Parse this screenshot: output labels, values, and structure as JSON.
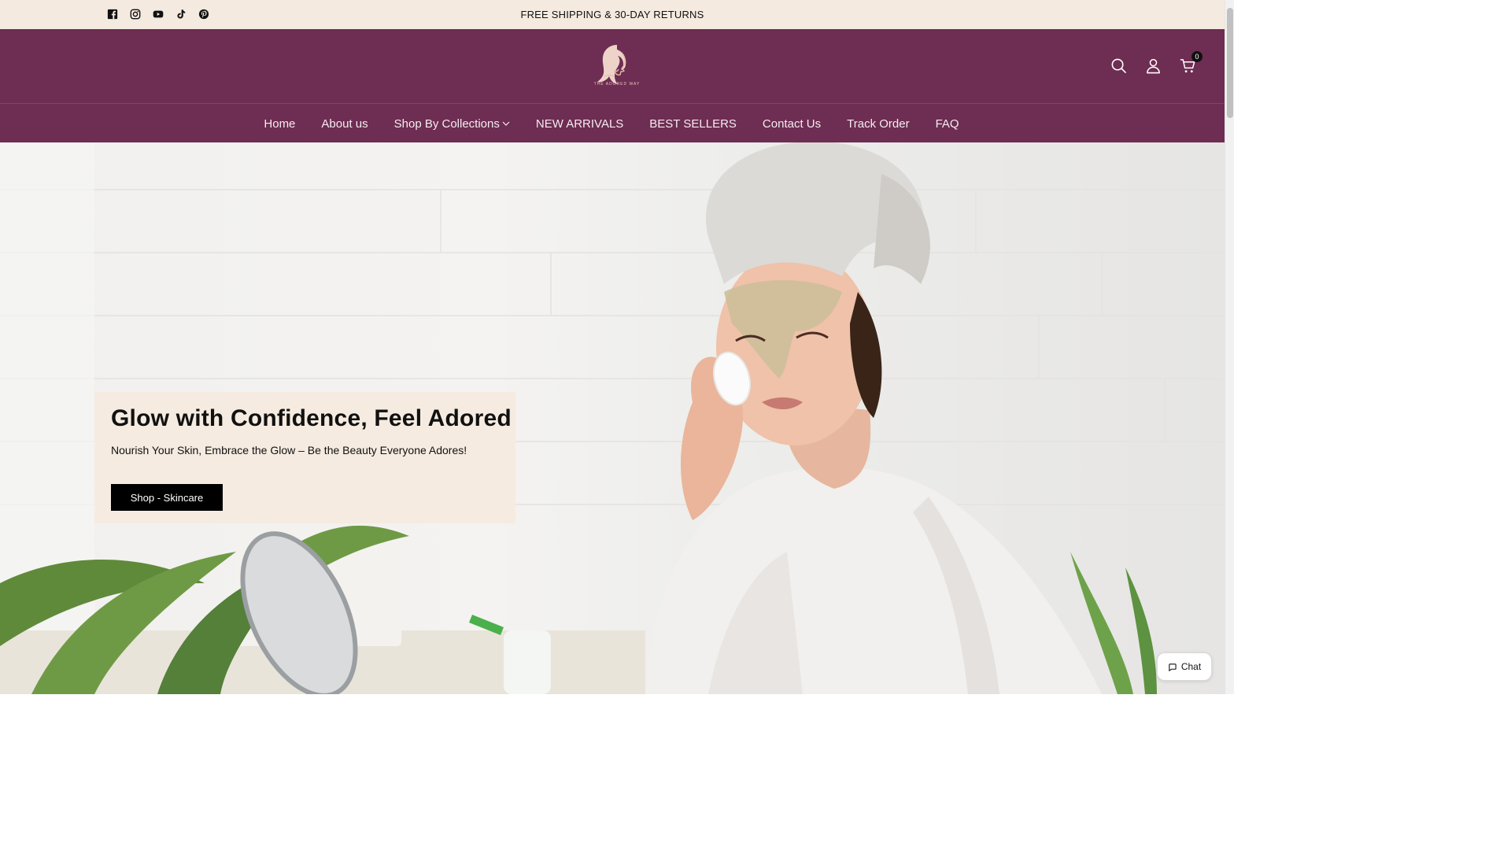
{
  "announcement": {
    "text": "FREE SHIPPING & 30-DAY RETURNS",
    "socials": [
      "facebook-icon",
      "instagram-icon",
      "youtube-icon",
      "tiktok-icon",
      "pinterest-icon"
    ]
  },
  "brand": {
    "logo_text": "THE ADORED WAY",
    "color": "#6e2d52",
    "accent": "#f4eae0"
  },
  "header": {
    "icons": [
      "search-icon",
      "account-icon",
      "cart-icon"
    ],
    "cart_count": "0"
  },
  "nav": {
    "items": [
      {
        "label": "Home"
      },
      {
        "label": "About us"
      },
      {
        "label": "Shop By Collections"
      },
      {
        "label": "NEW ARRIVALS"
      },
      {
        "label": "BEST SELLERS"
      },
      {
        "label": "Contact Us"
      },
      {
        "label": "Track Order"
      },
      {
        "label": "FAQ"
      }
    ]
  },
  "hero": {
    "title": "Glow with Confidence, Feel Adored",
    "subtitle": "Nourish Your Skin, Embrace the Glow – Be the Beauty Everyone Adores!",
    "button_label": "Shop - Skincare"
  },
  "chat": {
    "label": "Chat"
  }
}
